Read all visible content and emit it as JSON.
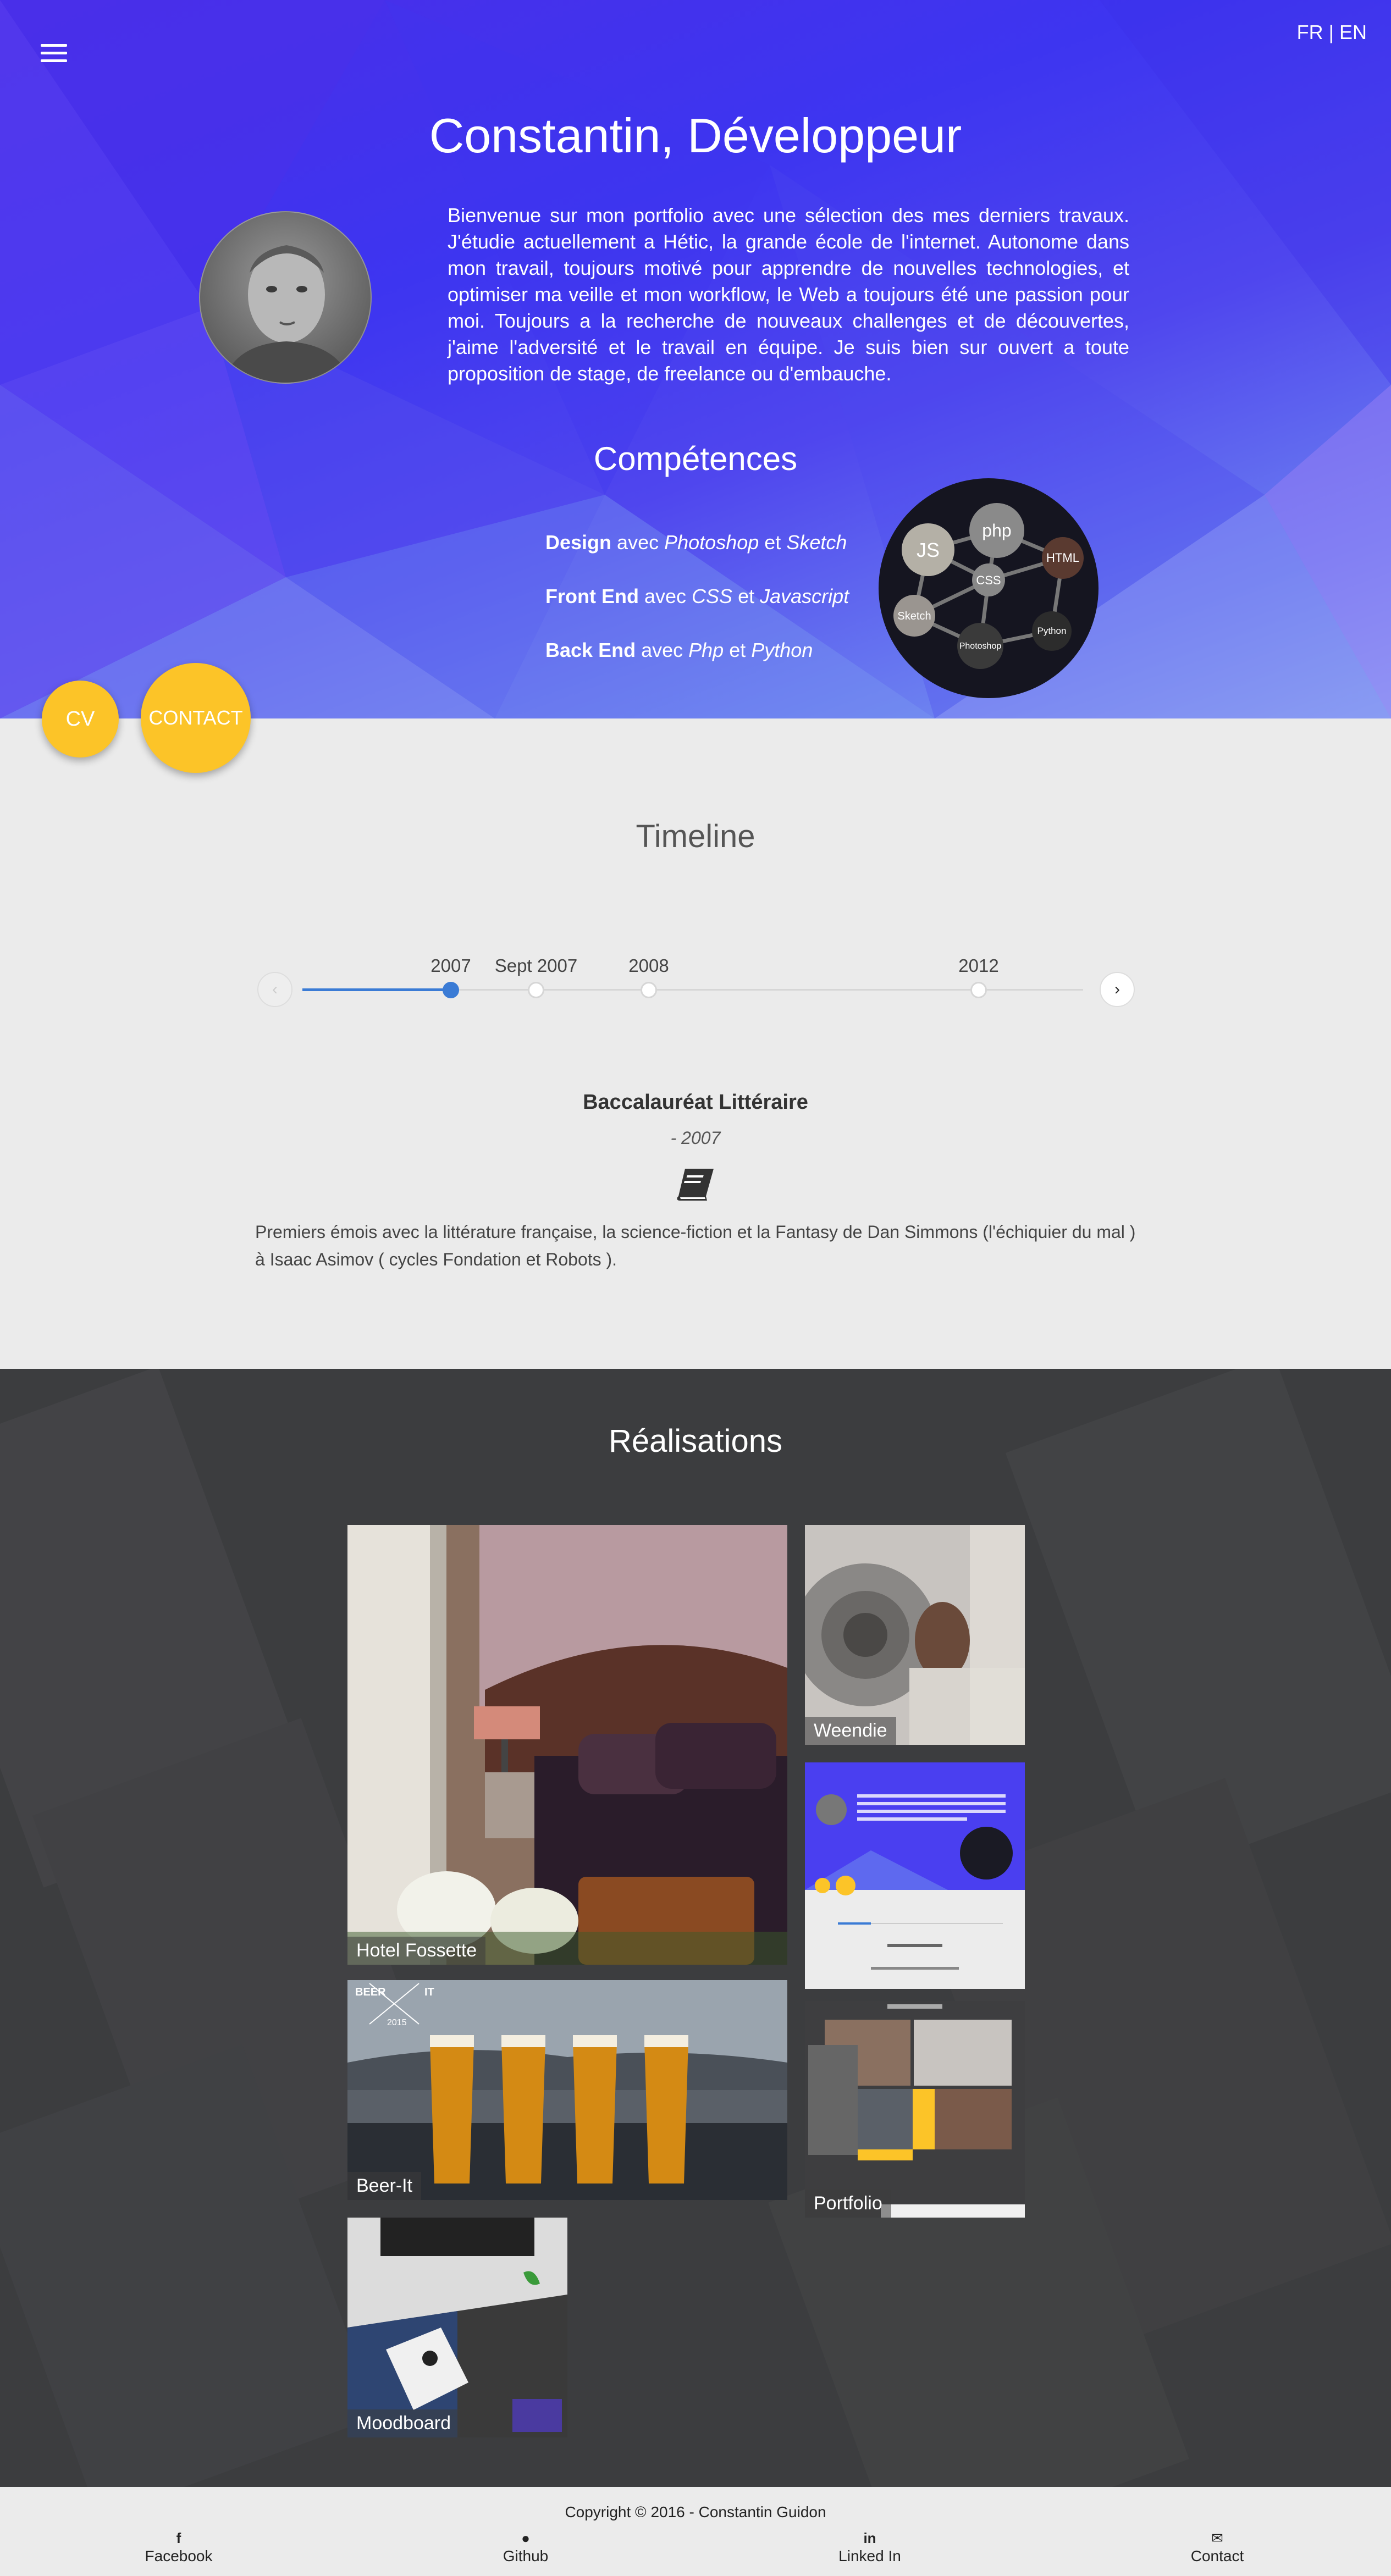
{
  "header": {
    "lang_fr": "FR",
    "lang_sep": "|",
    "lang_en": "EN",
    "title": "Constantin, Développeur",
    "bio": "Bienvenue sur mon portfolio avec une sélection des mes derniers travaux. J'étudie actuellement a Hétic, la grande école de l'internet. Autonome dans mon travail, toujours motivé pour apprendre de nouvelles technologies, et optimiser ma veille et mon workflow, le Web a toujours été une passion pour moi. Toujours a la recherche de nouveaux challenges et de découvertes, j'aime l'adversité et le travail en équipe. Je suis bien sur ouvert a toute proposition de stage, de freelance ou d'embauche."
  },
  "skills": {
    "title": "Compétences",
    "items": [
      {
        "area": "Design",
        "with": "avec",
        "tool1": "Photoshop",
        "and": "et",
        "tool2": "Sketch"
      },
      {
        "area": "Front End",
        "with": "avec",
        "tool1": "CSS",
        "and": "et",
        "tool2": "Javascript"
      },
      {
        "area": "Back End",
        "with": "avec",
        "tool1": "Php",
        "and": "et",
        "tool2": "Python"
      }
    ],
    "graph_nodes": [
      "JS",
      "php",
      "HTML",
      "CSS",
      "Sketch",
      "Photoshop",
      "Python"
    ]
  },
  "fabs": {
    "cv": "CV",
    "contact": "CONTACT"
  },
  "timeline": {
    "title": "Timeline",
    "dates": [
      "2007",
      "Sept 2007",
      "2008",
      "2012"
    ],
    "active_index": 0,
    "event": {
      "title": "Baccalauréat Littéraire",
      "date": "- 2007",
      "icon": "book-icon",
      "text": "Premiers émois avec la littérature française, la science-fiction et la Fantasy de Dan Simmons (l'échiquier du mal ) à Isaac Asimov ( cycles Fondation et Robots )."
    }
  },
  "realisations": {
    "title": "Réalisations",
    "projects": [
      "Hotel Fossette",
      "Weendie",
      "Beer-It",
      "Portfolio",
      "Moodboard"
    ],
    "beer_logo": {
      "left": "BEER",
      "right": "IT",
      "year": "2015"
    }
  },
  "footer": {
    "copyright": "Copyright © 2016 - Constantin Guidon",
    "links": [
      {
        "label": "Facebook",
        "icon": "facebook-icon"
      },
      {
        "label": "Github",
        "icon": "github-icon"
      },
      {
        "label": "Linked In",
        "icon": "linkedin-icon"
      },
      {
        "label": "Contact",
        "icon": "mail-icon"
      }
    ]
  },
  "colors": {
    "hero": "#3d35f0",
    "accent_yellow": "#fcc428",
    "timeline_blue": "#3a7bd5",
    "dark_section": "#3c3d3f"
  }
}
